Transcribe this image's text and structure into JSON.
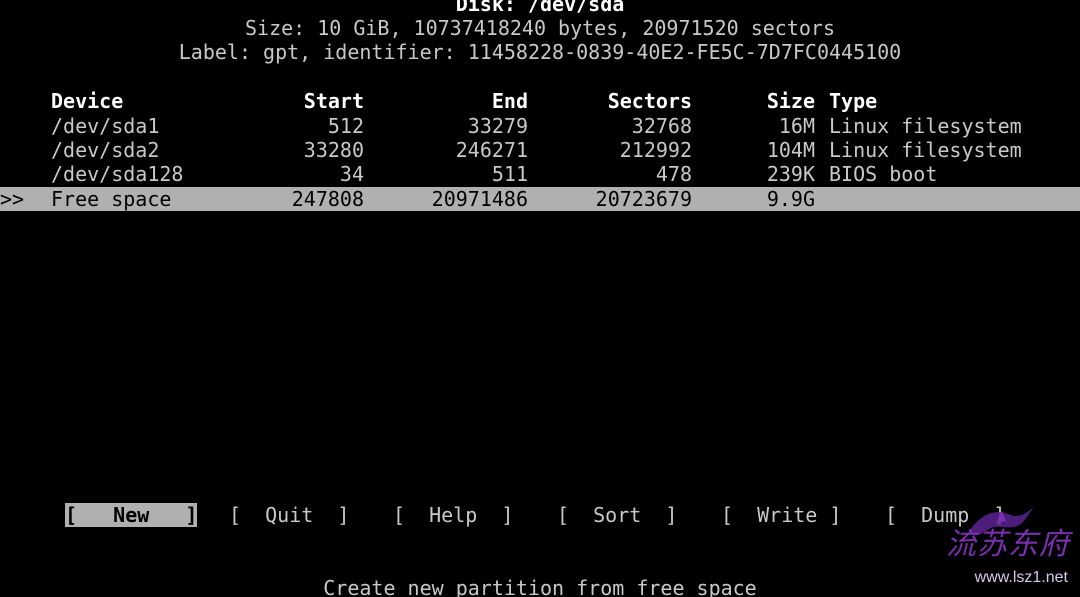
{
  "disk": {
    "title": "Disk: /dev/sda",
    "size": "Size: 10 GiB, 10737418240 bytes, 20971520 sectors",
    "label": "Label: gpt, identifier: 11458228-0839-40E2-FE5C-7D7FC0445100"
  },
  "table": {
    "headers": {
      "device": "Device",
      "start": "Start",
      "end": "End",
      "sectors": "Sectors",
      "size": "Size",
      "type": "Type"
    },
    "rows": [
      {
        "marker": "",
        "device": "/dev/sda1",
        "start": "512",
        "end": "33279",
        "sectors": "32768",
        "size": "16M",
        "type": "Linux filesystem"
      },
      {
        "marker": "",
        "device": "/dev/sda2",
        "start": "33280",
        "end": "246271",
        "sectors": "212992",
        "size": "104M",
        "type": "Linux filesystem"
      },
      {
        "marker": "",
        "device": "/dev/sda128",
        "start": "34",
        "end": "511",
        "sectors": "478",
        "size": "239K",
        "type": "BIOS boot"
      },
      {
        "marker": ">>",
        "device": "Free space",
        "start": "247808",
        "end": "20971486",
        "sectors": "20723679",
        "size": "9.9G",
        "type": ""
      }
    ]
  },
  "menu": {
    "items": [
      {
        "label": "[   New   ]"
      },
      {
        "label": "[  Quit  ]"
      },
      {
        "label": "[  Help  ]"
      },
      {
        "label": "[  Sort  ]"
      },
      {
        "label": "[  Write ]"
      },
      {
        "label": "[  Dump  ]"
      }
    ]
  },
  "status": "Create new partition from free space",
  "watermark": {
    "logo_text": "流苏东府",
    "url": "www.lsz1.net",
    "color": "#7a2fb0"
  },
  "colors": {
    "background": "#000000",
    "foreground": "#c8c8c8",
    "highlight": "#b0b0b0"
  }
}
